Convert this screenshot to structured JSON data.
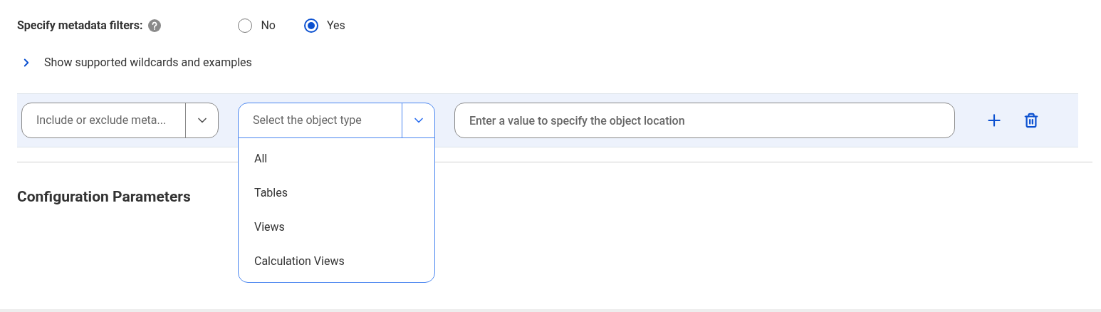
{
  "metadata_filters": {
    "label": "Specify metadata filters:",
    "options": [
      {
        "label": "No",
        "selected": false
      },
      {
        "label": "Yes",
        "selected": true
      }
    ]
  },
  "wildcards_toggle": {
    "label": "Show supported wildcards and examples",
    "expanded": false
  },
  "filter_row": {
    "rule_select": {
      "placeholder": "Include or exclude meta..."
    },
    "object_type_select": {
      "placeholder": "Select the object type",
      "expanded": true,
      "options": [
        "All",
        "Tables",
        "Views",
        "Calculation Views"
      ]
    },
    "location_field": {
      "placeholder": "Enter a value to specify the object location"
    }
  },
  "section_heading": "Configuration Parameters"
}
